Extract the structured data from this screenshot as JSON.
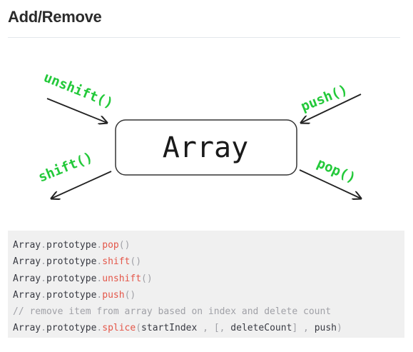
{
  "section": {
    "title": "Add/Remove"
  },
  "diagram": {
    "center_label": "Array",
    "methods": {
      "unshift": "unshift()",
      "push": "push()",
      "shift": "shift()",
      "pop": "pop()"
    },
    "colors": {
      "method_text": "#23c93a",
      "arrow": "#222222",
      "box_border": "#333333"
    }
  },
  "code": {
    "lines": [
      {
        "obj": "Array",
        "dot1": ".",
        "proto": "prototype",
        "dot2": ".",
        "method": "pop",
        "paren_open": "(",
        "paren_close": ")"
      },
      {
        "obj": "Array",
        "dot1": ".",
        "proto": "prototype",
        "dot2": ".",
        "method": "shift",
        "paren_open": "(",
        "paren_close": ")"
      },
      {
        "obj": "Array",
        "dot1": ".",
        "proto": "prototype",
        "dot2": ".",
        "method": "unshift",
        "paren_open": "(",
        "paren_close": ")"
      },
      {
        "obj": "Array",
        "dot1": ".",
        "proto": "prototype",
        "dot2": ".",
        "method": "push",
        "paren_open": "(",
        "paren_close": ")"
      }
    ],
    "comment": "// remove item from array based on index and delete count",
    "splice": {
      "obj": "Array",
      "dot1": ".",
      "proto": "prototype",
      "dot2": ".",
      "method": "splice",
      "paren_open": "(",
      "arg1": "startIndex",
      "sep1": " , ",
      "bracket_open": "[",
      "sep2": ", ",
      "arg2": "deleteCount",
      "bracket_close": "]",
      "sep3": " , ",
      "arg3": "push",
      "paren_close": ")"
    }
  }
}
